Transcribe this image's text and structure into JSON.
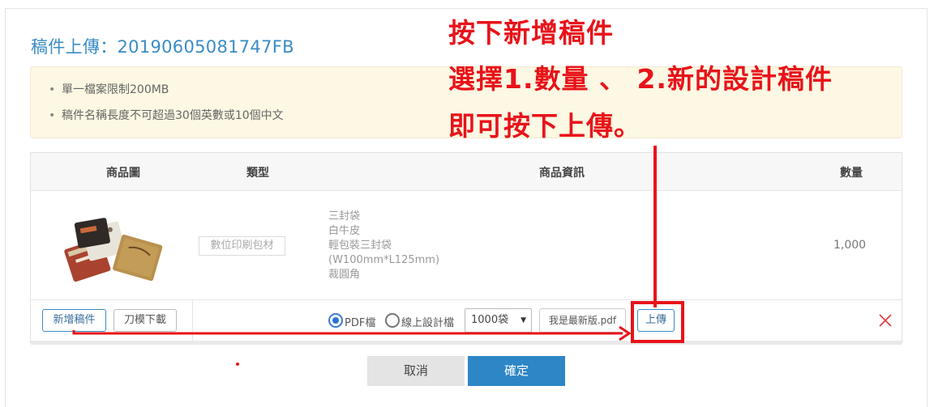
{
  "page": {
    "title": "稿件上傳：20190605081747FB"
  },
  "notice": {
    "items": [
      "單一檔案限制200MB",
      "稿件名稱長度不可超過30個英數或10個中文"
    ]
  },
  "table": {
    "headers": {
      "image": "商品圖",
      "type": "類型",
      "info": "商品資訊",
      "quantity": "數量"
    },
    "row": {
      "type_tag": "數位印刷包材",
      "info_lines": [
        "三封袋",
        "白牛皮",
        "輕包裝三封袋",
        "(W100mm*L125mm)",
        "裁圓角"
      ],
      "quantity": "1,000"
    }
  },
  "actions": {
    "add_label": "新增稿件",
    "die_download_label": "刀模下載",
    "radio_pdf_label": "PDF檔",
    "radio_online_label": "線上設計檔",
    "radio_selected": "pdf",
    "quantity_select_value": "1000袋",
    "file_name": "我是最新版.pdf",
    "upload_label": "上傳",
    "delete_icon": "close-icon"
  },
  "footer": {
    "cancel_label": "取消",
    "confirm_label": "確定"
  },
  "annotation": {
    "lines": [
      "按下新增稿件",
      "選擇1.數量 、 2.新的設計稿件",
      "即可按下上傳。"
    ],
    "color": "#e8131a"
  },
  "colors": {
    "accent": "#2d86c6",
    "notice_bg": "#fcf8e3",
    "title": "#3a8cc4"
  }
}
